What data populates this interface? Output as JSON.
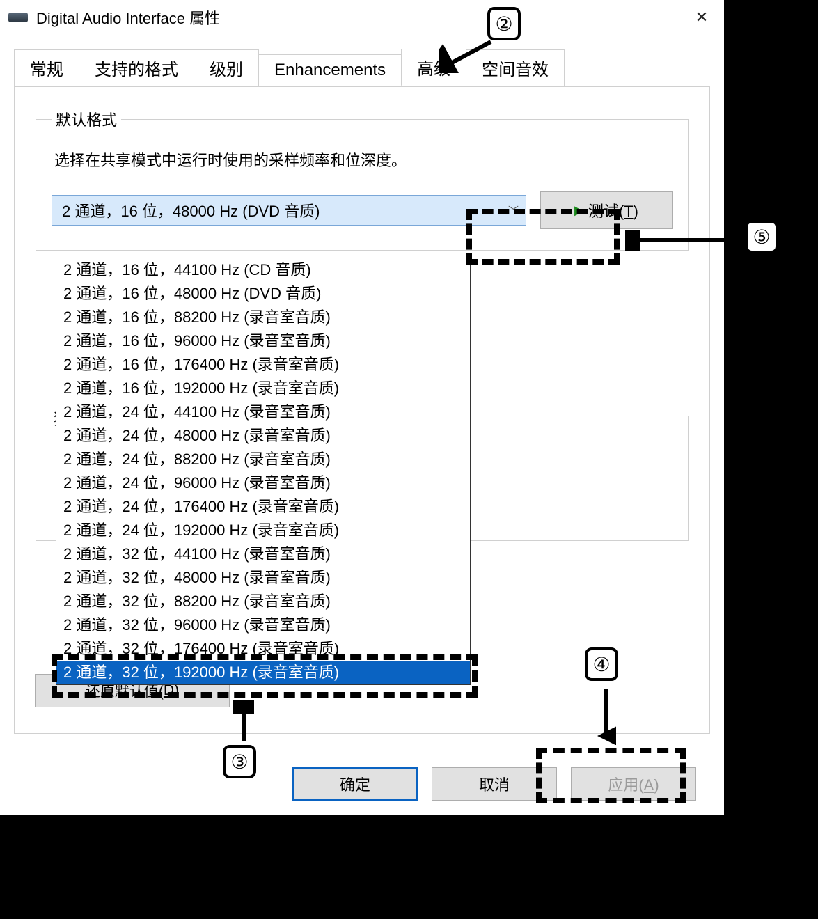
{
  "window": {
    "title": "Digital Audio Interface 属性"
  },
  "tabs": {
    "items": [
      "常规",
      "支持的格式",
      "级别",
      "Enhancements",
      "高级",
      "空间音效"
    ],
    "active_index": 4
  },
  "group_default_format": {
    "legend": "默认格式",
    "description": "选择在共享模式中运行时使用的采样频率和位深度。",
    "selected": "2 通道，16 位，48000 Hz (DVD 音质)",
    "options": [
      "2 通道，16 位，44100 Hz (CD 音质)",
      "2 通道，16 位，48000 Hz (DVD 音质)",
      "2 通道，16 位，88200 Hz (录音室音质)",
      "2 通道，16 位，96000 Hz (录音室音质)",
      "2 通道，16 位，176400 Hz (录音室音质)",
      "2 通道，16 位，192000 Hz (录音室音质)",
      "2 通道，24 位，44100 Hz (录音室音质)",
      "2 通道，24 位，48000 Hz (录音室音质)",
      "2 通道，24 位，88200 Hz (录音室音质)",
      "2 通道，24 位，96000 Hz (录音室音质)",
      "2 通道，24 位，176400 Hz (录音室音质)",
      "2 通道，24 位，192000 Hz (录音室音质)",
      "2 通道，32 位，44100 Hz (录音室音质)",
      "2 通道，32 位，48000 Hz (录音室音质)",
      "2 通道，32 位，88200 Hz (录音室音质)",
      "2 通道，32 位，96000 Hz (录音室音质)",
      "2 通道，32 位，176400 Hz (录音室音质)",
      "2 通道，32 位，192000 Hz (录音室音质)"
    ],
    "highlighted_index": 17,
    "test_button": "▶ 测试(T)"
  },
  "group_exclusive": {
    "legend_partial": "独"
  },
  "restore_button": "还原默认值(D)",
  "dialog_buttons": {
    "ok": "确定",
    "cancel": "取消",
    "apply": "应用(A)"
  },
  "callouts": {
    "c2": "②",
    "c3": "③",
    "c4": "④",
    "c5": "⑤"
  }
}
